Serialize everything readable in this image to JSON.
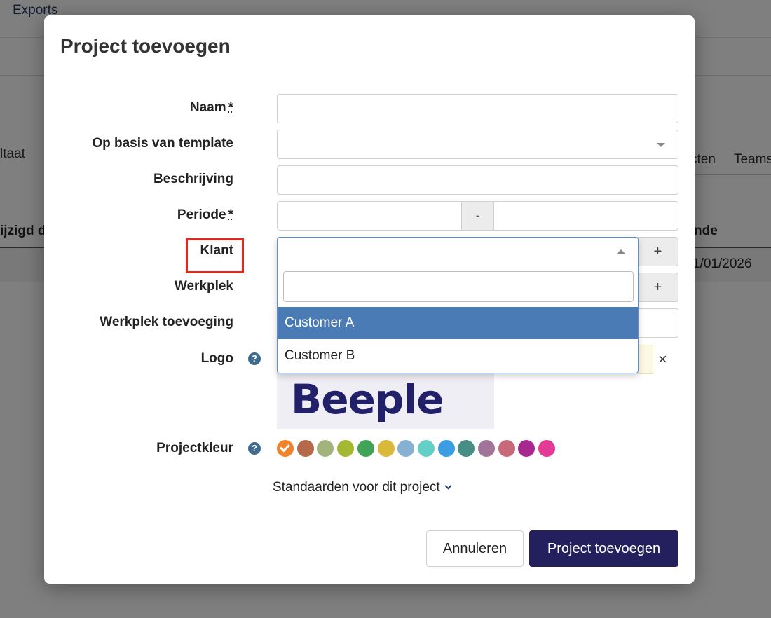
{
  "background": {
    "nav_exports": "Exports",
    "resultaat_fragment": "ltaat",
    "tabs": [
      "cten",
      "Teams"
    ],
    "table_header_left": "ijzigd d",
    "table_header_right": "nde",
    "row_date": "1/01/2026"
  },
  "modal": {
    "title": "Project toevoegen",
    "fields": {
      "name_label": "Naam",
      "required_mark": "*",
      "template_label": "Op basis van template",
      "description_label": "Beschrijving",
      "period_label": "Periode",
      "period_separator": "-",
      "client_label": "Klant",
      "workplace_label": "Werkplek",
      "workplace_addition_label": "Werkplek toevoeging",
      "logo_label": "Logo",
      "color_label": "Projectkleur",
      "add_symbol": "+",
      "remove_symbol": "×",
      "help_symbol": "?"
    },
    "client_dropdown": {
      "search_value": "",
      "options": [
        "Customer A",
        "Customer B"
      ],
      "highlighted_option": "Customer A"
    },
    "logo_preview_text": "Beeple",
    "colors": [
      "#f0842d",
      "#b5694a",
      "#a3b37e",
      "#a5b834",
      "#41a358",
      "#d9b83a",
      "#86b1d3",
      "#62d0c6",
      "#3b9de3",
      "#478e86",
      "#a17499",
      "#c76979",
      "#a7288f",
      "#e23a95"
    ],
    "selected_color": "#f0842d",
    "defaults_toggle": "Standaarden voor dit project",
    "cancel_label": "Annuleren",
    "submit_label": "Project toevoegen"
  }
}
